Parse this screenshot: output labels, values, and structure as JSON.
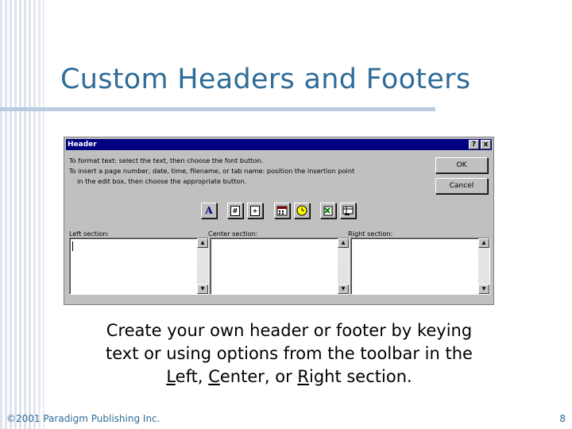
{
  "slide": {
    "title": "Custom Headers and Footers",
    "body_line1": "Create your own header or footer by keying",
    "body_line2": "text or using options from the toolbar in the",
    "body_line3_pre1": "",
    "body_line3_l": "L",
    "body_line3_eft": "eft, ",
    "body_line3_c": "C",
    "body_line3_enter": "enter, or ",
    "body_line3_r": "R",
    "body_line3_ight": "ight section.",
    "footer_left": "©2001 Paradigm Publishing Inc.",
    "footer_right": "8",
    "title_color": "#2f6c98"
  },
  "dialog": {
    "title": "Header",
    "help_label": "?",
    "close_label": "x",
    "instruction_1": "To format text:   select the text, then choose the font button.",
    "instruction_2": "To insert a page number, date, time, filename, or tab name:  position the insertion point",
    "instruction_3": "in the edit box, then choose the appropriate button.",
    "ok_label": "OK",
    "cancel_label": "Cancel",
    "toolbar": {
      "font_icon_glyph": "A",
      "page_number_glyph": "#",
      "total_pages_glyph": "+"
    },
    "left_section_label": "Left section:",
    "center_section_label": "Center section:",
    "right_section_label": "Right section:",
    "left_section_value": "",
    "center_section_value": "",
    "right_section_value": "",
    "titlebar_color": "#000080"
  }
}
